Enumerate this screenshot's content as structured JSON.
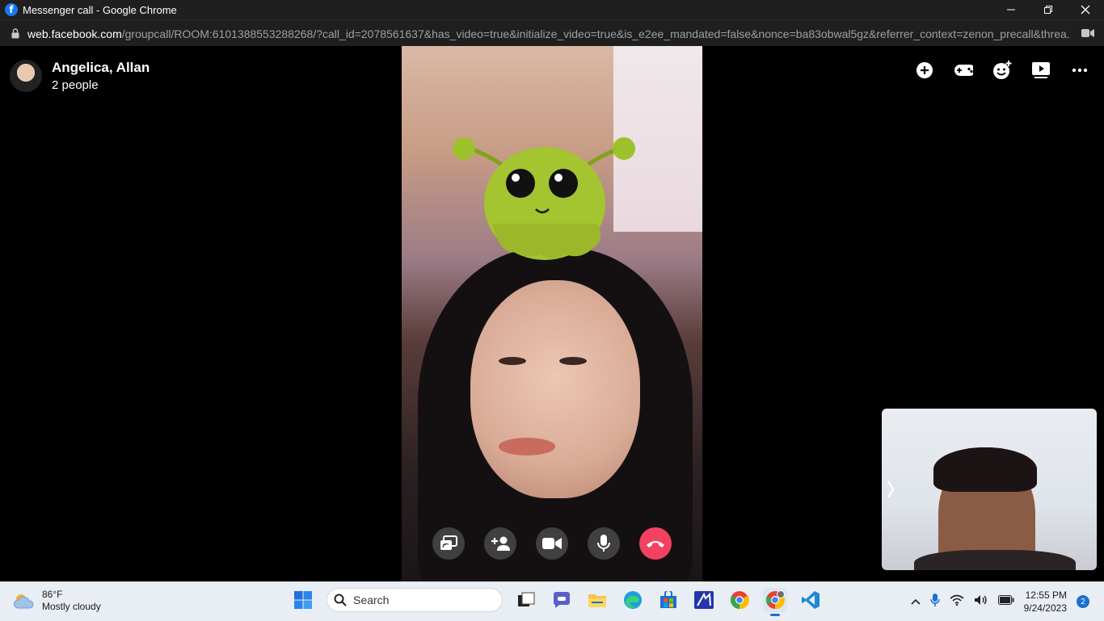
{
  "window": {
    "title": "Messenger call - Google Chrome",
    "url_host": "web.facebook.com",
    "url_path": "/groupcall/ROOM:6101388553288268/?call_id=2078561637&has_video=true&initialize_video=true&is_e2ee_mandated=false&nonce=ba83obwal5gz&referrer_context=zenon_precall&threa..."
  },
  "call": {
    "name": "Angelica, Allan",
    "people": "2 people",
    "top_icons": [
      "add-icon",
      "game-controller-icon",
      "effects-icon",
      "watch-together-icon",
      "more-icon"
    ],
    "controls": [
      "screen-share-icon",
      "add-person-icon",
      "video-camera-icon",
      "microphone-icon",
      "end-call-icon"
    ],
    "end_color": "#f3425f"
  },
  "taskbar": {
    "weather_temp": "86°F",
    "weather_desc": "Mostly cloudy",
    "search_placeholder": "Search",
    "apps": [
      "windows-start-icon",
      "search-icon",
      "task-view-icon",
      "teams-chat-icon",
      "file-explorer-icon",
      "edge-icon",
      "microsoft-store-icon",
      "app-icon",
      "chrome-icon",
      "chrome-profile-icon",
      "vscode-icon"
    ],
    "time": "12:55 PM",
    "date": "9/24/2023",
    "notifications": "2"
  }
}
